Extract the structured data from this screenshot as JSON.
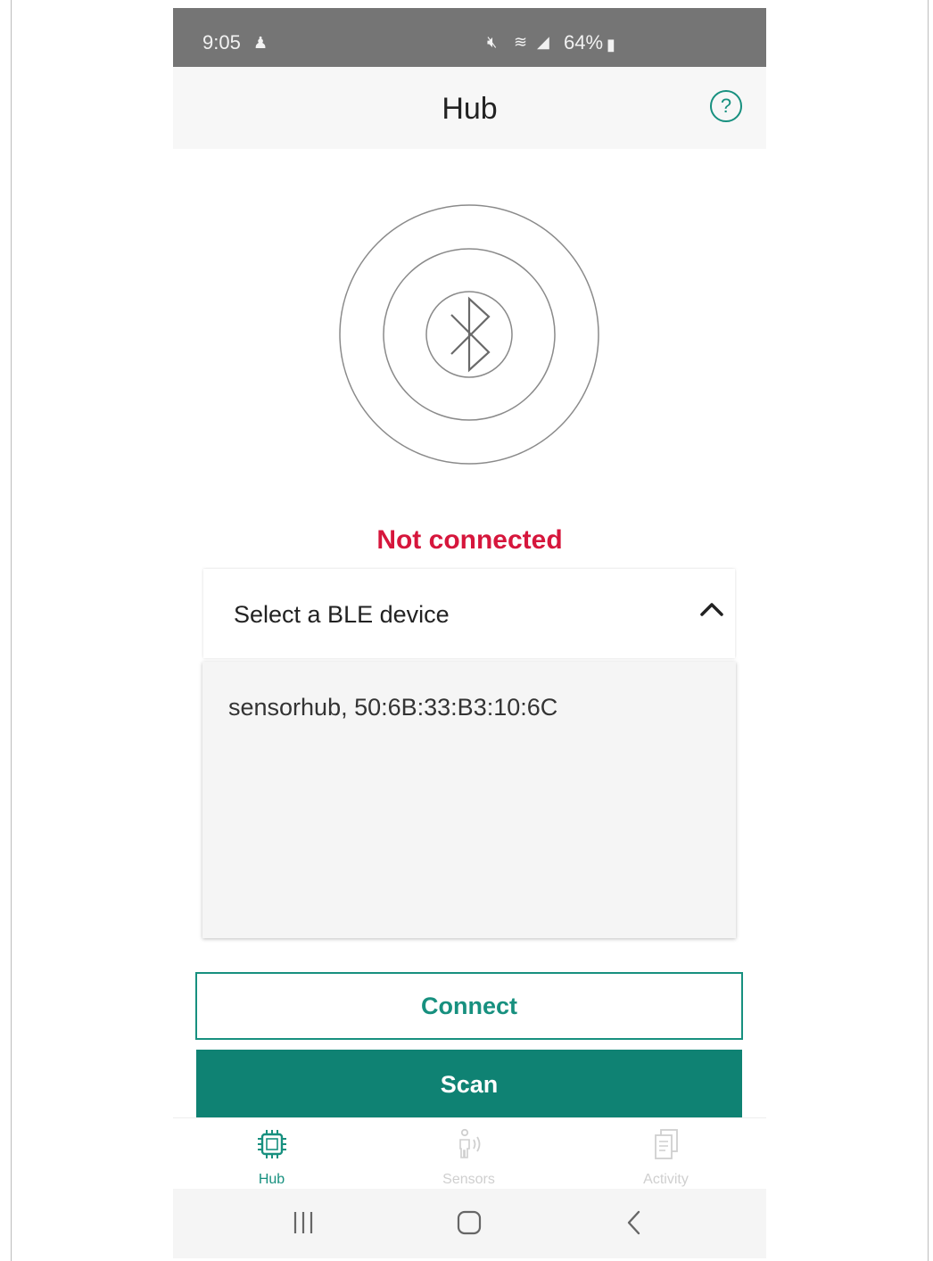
{
  "status_bar": {
    "time": "9:05",
    "battery": "64%"
  },
  "app_bar": {
    "title": "Hub"
  },
  "connection": {
    "status_text": "Not connected",
    "status_color": "#d6163c"
  },
  "device_select": {
    "label": "Select a BLE device",
    "options": [
      "sensorhub, 50:6B:33:B3:10:6C"
    ]
  },
  "buttons": {
    "connect_label": "Connect",
    "scan_label": "Scan"
  },
  "bottom_nav": {
    "items": [
      {
        "label": "Hub",
        "icon": "chip-icon",
        "active": true
      },
      {
        "label": "Sensors",
        "icon": "person-signal-icon",
        "active": false
      },
      {
        "label": "Activity",
        "icon": "documents-icon",
        "active": false
      }
    ]
  },
  "colors": {
    "accent": "#17907f",
    "scan_button": "#0f8273",
    "status_bar": "#757575"
  }
}
